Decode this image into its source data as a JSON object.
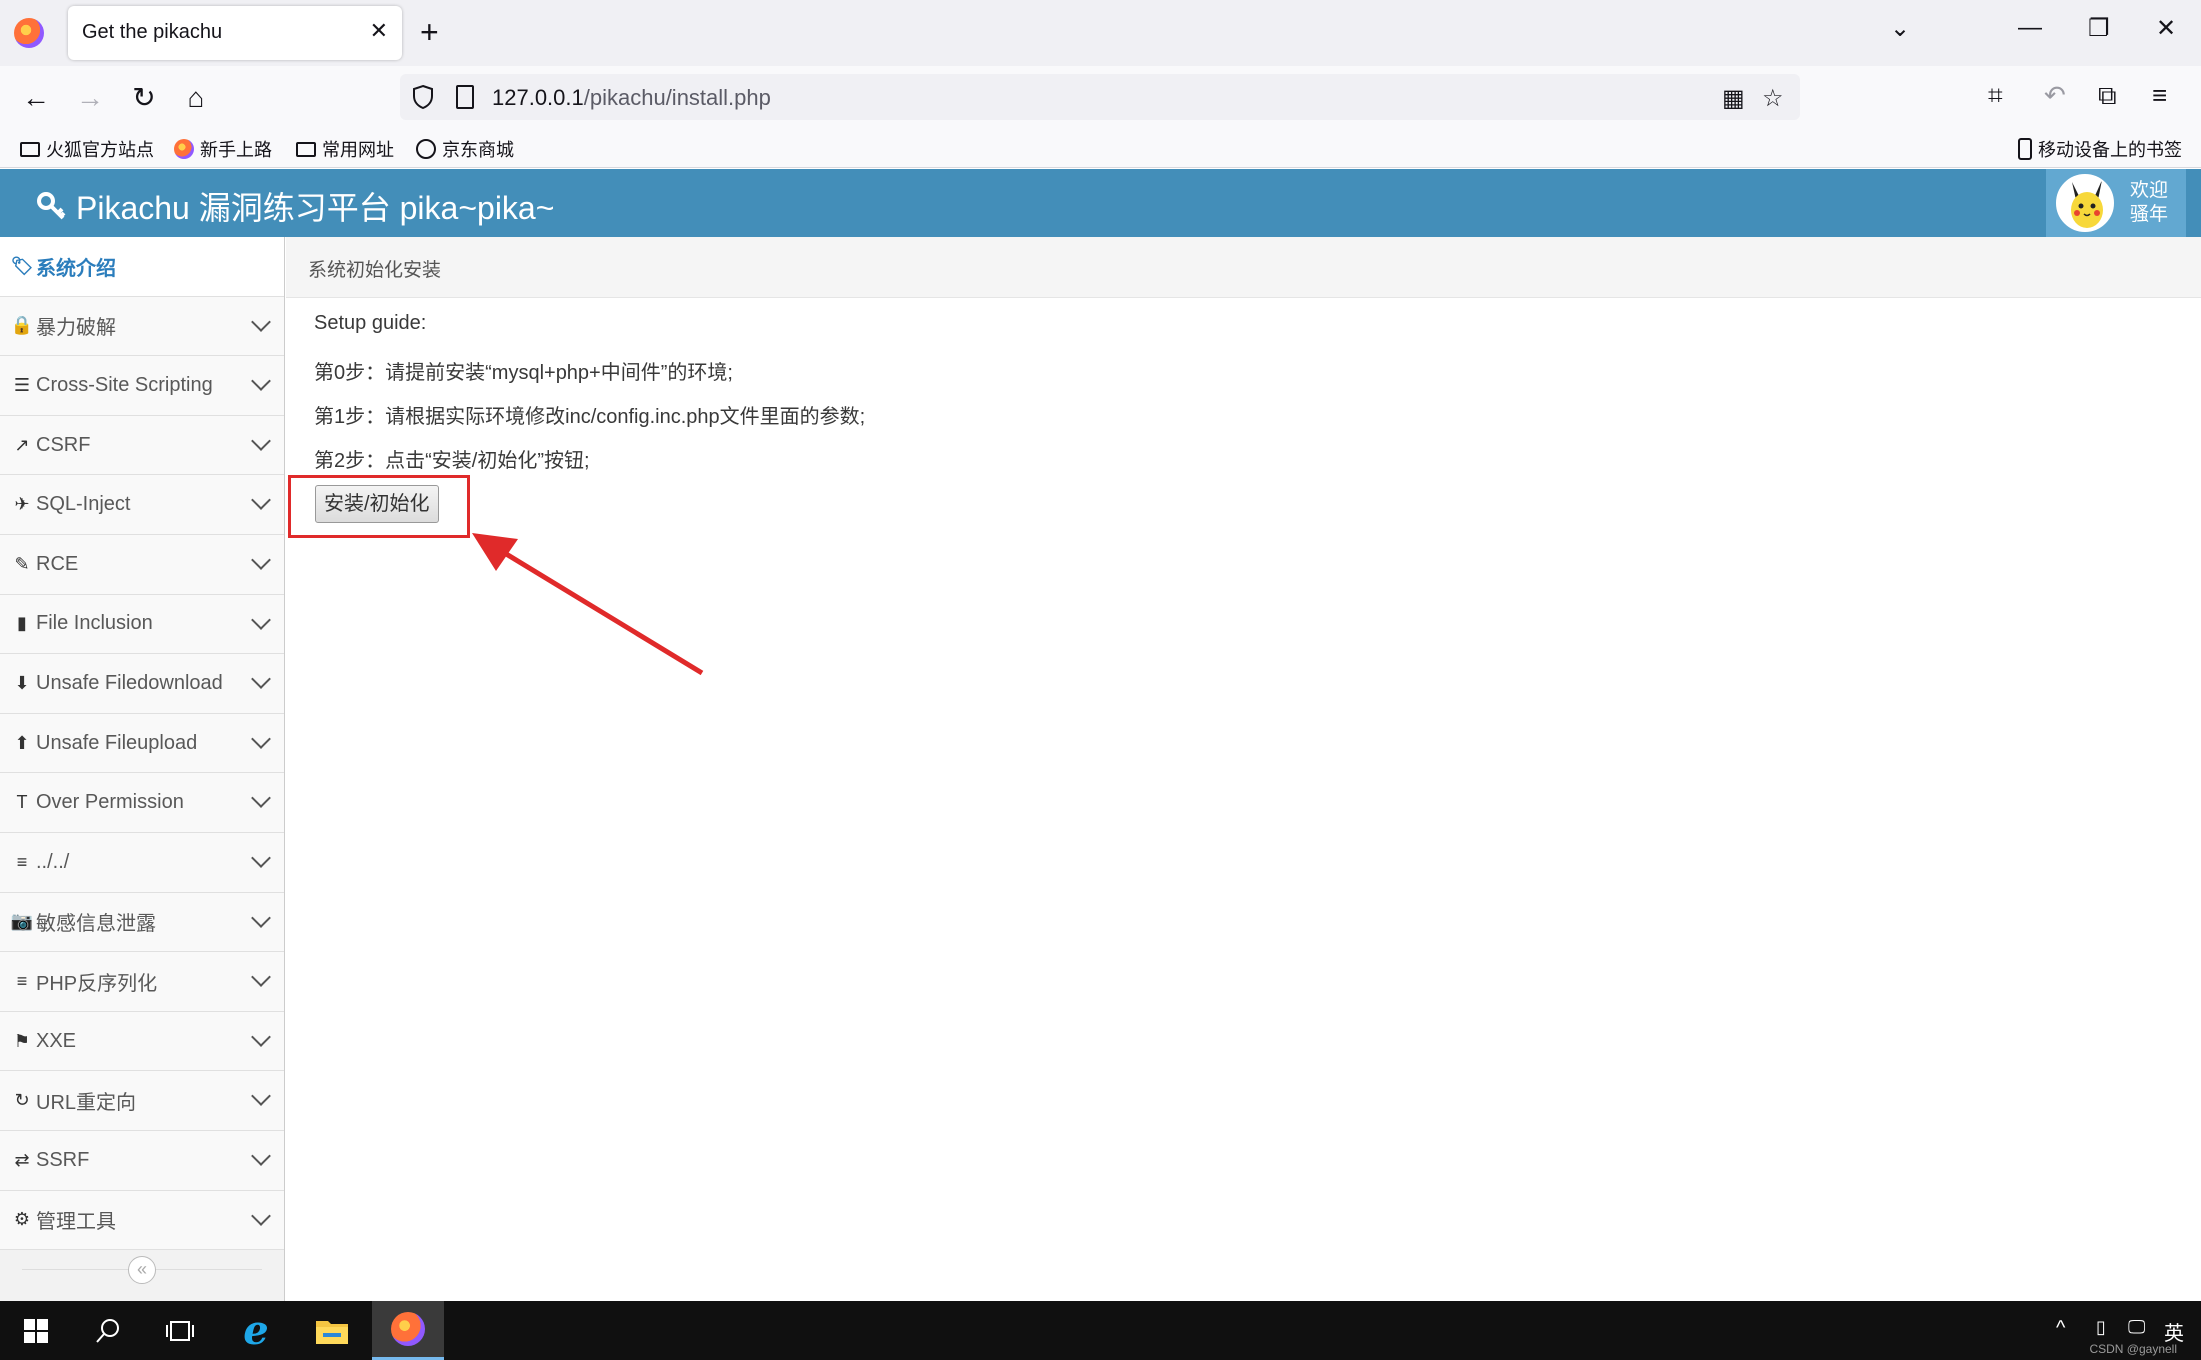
{
  "browser": {
    "tab_title": "Get the pikachu",
    "url_host": "127.0.0.1",
    "url_path": "/pikachu/install.php",
    "bookmarks": [
      "火狐官方站点",
      "新手上路",
      "常用网址",
      "京东商城"
    ],
    "mobile_bookmarks": "移动设备上的书签"
  },
  "header": {
    "brand": "Pikachu 漏洞练习平台 pika~pika~",
    "welcome_line1": "欢迎",
    "welcome_line2": "骚年"
  },
  "sidebar": {
    "items": [
      {
        "label": "系统介绍",
        "icon": "tags-icon",
        "glyph": "🏷"
      },
      {
        "label": "暴力破解",
        "icon": "lock-icon",
        "glyph": "🔒"
      },
      {
        "label": "Cross-Site Scripting",
        "icon": "list-indent-icon",
        "glyph": "☰"
      },
      {
        "label": "CSRF",
        "icon": "share-icon",
        "glyph": "↗"
      },
      {
        "label": "SQL-Inject",
        "icon": "plane-icon",
        "glyph": "✈"
      },
      {
        "label": "RCE",
        "icon": "pencil-icon",
        "glyph": "✎"
      },
      {
        "label": "File Inclusion",
        "icon": "file-icon",
        "glyph": "▮"
      },
      {
        "label": "Unsafe Filedownload",
        "icon": "download-icon",
        "glyph": "⬇"
      },
      {
        "label": "Unsafe Fileupload",
        "icon": "upload-icon",
        "glyph": "⬆"
      },
      {
        "label": "Over Permission",
        "icon": "text-height-icon",
        "glyph": "T"
      },
      {
        "label": "../../",
        "icon": "align-left-icon",
        "glyph": "≡"
      },
      {
        "label": "敏感信息泄露",
        "icon": "camera-icon",
        "glyph": "📷"
      },
      {
        "label": "PHP反序列化",
        "icon": "align-left-icon",
        "glyph": "≡"
      },
      {
        "label": "XXE",
        "icon": "flag-icon",
        "glyph": "⚑"
      },
      {
        "label": "URL重定向",
        "icon": "refresh-icon",
        "glyph": "↻"
      },
      {
        "label": "SSRF",
        "icon": "exchange-icon",
        "glyph": "⇄"
      },
      {
        "label": "管理工具",
        "icon": "gear-icon",
        "glyph": "⚙"
      }
    ]
  },
  "breadcrumb": "系统初始化安装",
  "main": {
    "lines": [
      "Setup guide:",
      "第0步：请提前安装“mysql+php+中间件”的环境;",
      "第1步：请根据实际环境修改inc/config.inc.php文件里面的参数;",
      "第2步：点击“安装/初始化”按钮;"
    ],
    "install_button": "安装/初始化"
  },
  "taskbar": {
    "lang": "英",
    "watermark": "CSDN @gaynell"
  },
  "colors": {
    "header_bg": "#438eb9",
    "accent": "#2b7dbc",
    "annotation": "#e02a2a"
  }
}
